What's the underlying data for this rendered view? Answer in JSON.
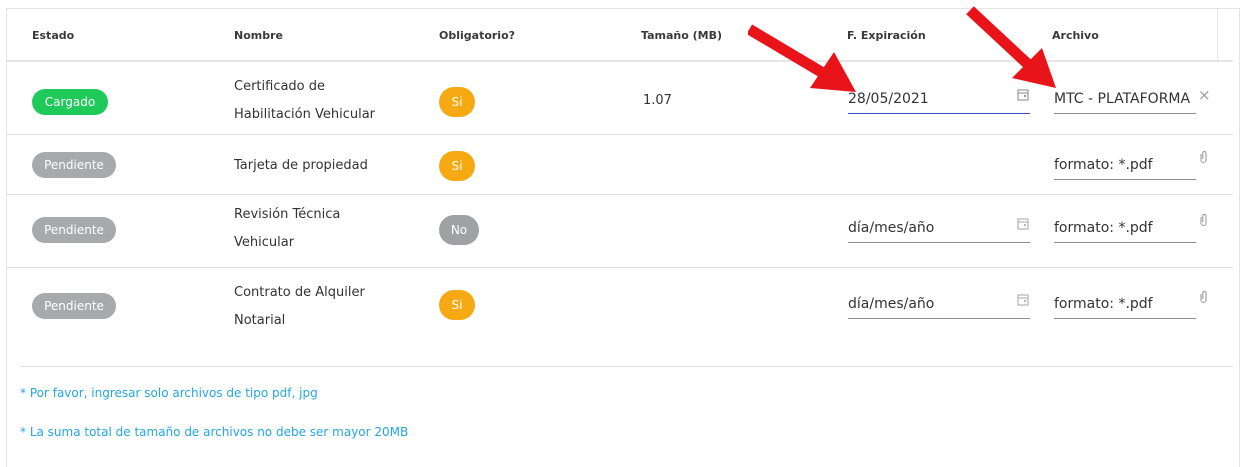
{
  "table": {
    "headers": {
      "estado": "Estado",
      "nombre": "Nombre",
      "obligatorio": "Obligatorio?",
      "tamano": "Tamaño (MB)",
      "expiracion": "F. Expiración",
      "archivo": "Archivo"
    },
    "rows": [
      {
        "status": "Cargado",
        "name_line1": "Certificado de",
        "name_line2": "Habilitación Vehicular",
        "required": "Si",
        "size": "1.07",
        "expiration": "28/05/2021",
        "file": "MTC - PLATAFORMA"
      },
      {
        "status": "Pendiente",
        "name_line1": "Tarjeta de propiedad",
        "required": "Si",
        "size": "",
        "file": "formato: *.pdf"
      },
      {
        "status": "Pendiente",
        "name_line1": "Revisión Técnica",
        "name_line2": "Vehicular",
        "required": "No",
        "size": "",
        "expiration": "día/mes/año",
        "file": "formato: *.pdf"
      },
      {
        "status": "Pendiente",
        "name_line1": "Contrato de Alquiler",
        "name_line2": "Notarial",
        "required": "Si",
        "size": "",
        "expiration": "día/mes/año",
        "file": "formato: *.pdf"
      }
    ]
  },
  "notes": {
    "line1": "* Por favor, ingresar solo archivos de tipo pdf, jpg",
    "line2": "* La suma total de tamaño de archivos no debe ser mayor 20MB"
  },
  "colors": {
    "loaded": "#1fca5b",
    "pending": "#a8a9ad",
    "yes": "#f6a912",
    "no": "#a0a1a5",
    "note": "#26a5e0",
    "focus": "#3b4fc7",
    "annotation_arrow": "#e8141a"
  },
  "icons": {
    "date": "calendar-icon",
    "clear": "close-icon",
    "attach": "paperclip-icon",
    "annotation": "red-arrow"
  }
}
